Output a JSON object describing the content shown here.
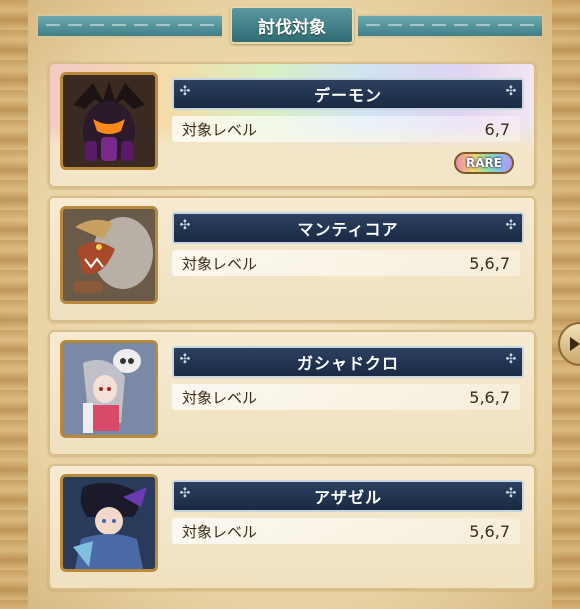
{
  "header": {
    "title": "討伐対象"
  },
  "targets": [
    {
      "name": "デーモン",
      "level_label": "対象レベル",
      "level_value": "6,7",
      "rare": true,
      "rare_label": "RARE",
      "portrait_icon": "demon-portrait-icon"
    },
    {
      "name": "マンティコア",
      "level_label": "対象レベル",
      "level_value": "5,6,7",
      "rare": false,
      "portrait_icon": "manticore-portrait-icon"
    },
    {
      "name": "ガシャドクロ",
      "level_label": "対象レベル",
      "level_value": "5,6,7",
      "rare": false,
      "portrait_icon": "gashadokuro-portrait-icon"
    },
    {
      "name": "アザゼル",
      "level_label": "対象レベル",
      "level_value": "5,6,7",
      "rare": false,
      "portrait_icon": "azazel-portrait-icon"
    }
  ],
  "colors": {
    "header_teal": "#3f7f88",
    "name_plate_navy": "#1a2a44",
    "card_bg": "#f3e6c8",
    "portrait_border": "#b88a3a"
  }
}
